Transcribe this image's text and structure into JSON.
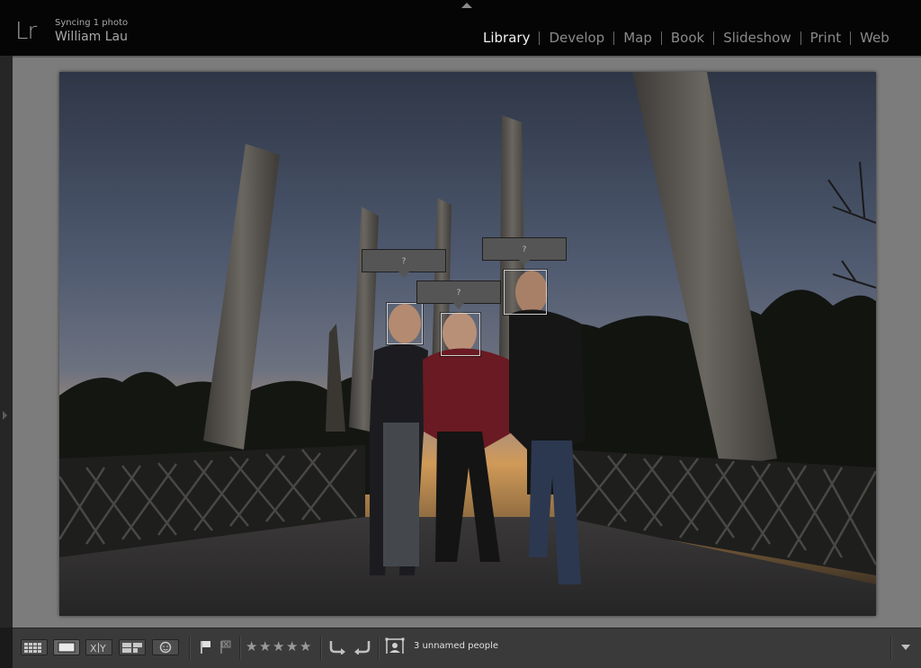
{
  "topbar": {
    "logo": "Lr",
    "sync_status": "Syncing 1 photo",
    "user_name": "William Lau"
  },
  "modules": [
    {
      "label": "Library",
      "active": true
    },
    {
      "label": "Develop",
      "active": false
    },
    {
      "label": "Map",
      "active": false
    },
    {
      "label": "Book",
      "active": false
    },
    {
      "label": "Slideshow",
      "active": false
    },
    {
      "label": "Print",
      "active": false
    },
    {
      "label": "Web",
      "active": false
    }
  ],
  "faces": [
    {
      "tag": "?"
    },
    {
      "tag": "?"
    },
    {
      "tag": "?"
    }
  ],
  "toolbar": {
    "view_modes": [
      "grid-view-icon",
      "loupe-view-icon",
      "compare-view-icon",
      "survey-view-icon",
      "people-view-icon"
    ],
    "active_view": "loupe-view-icon",
    "rating": 0,
    "people_status": "3 unnamed people"
  },
  "colors": {
    "topbar_bg": "#050505",
    "active_module": "#f2f2f2",
    "inactive_module": "#8a8a8a",
    "preview_bg": "#7c7c7c",
    "toolbar_bg": "#3a3a3a"
  }
}
